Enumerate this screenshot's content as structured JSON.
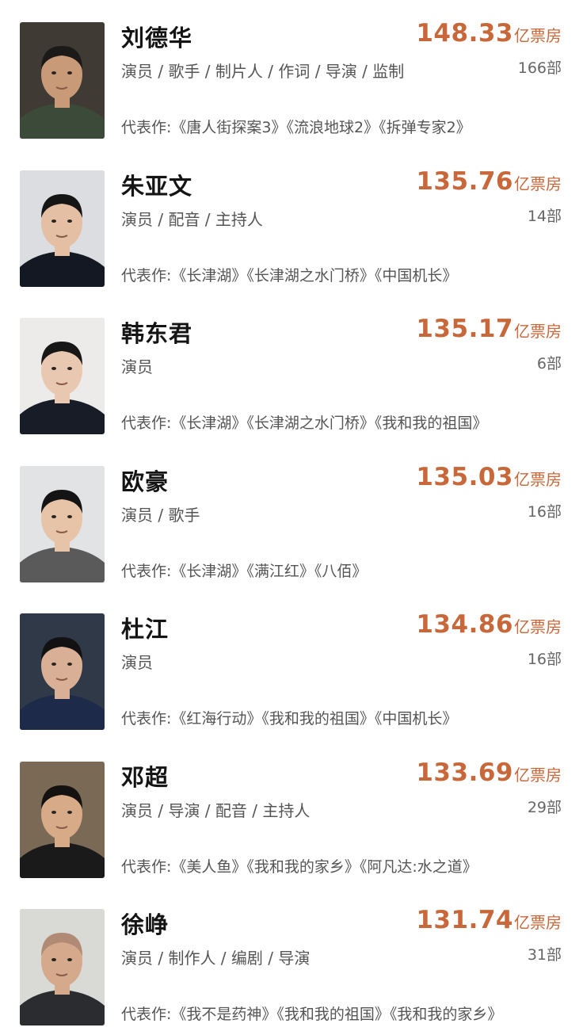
{
  "actors": [
    {
      "name": "刘德华",
      "roles": "演员 / 歌手 / 制片人 / 作词 / 导演 / 监制",
      "box_value": "148.33",
      "box_unit": "亿票房",
      "film_count": "166部",
      "works": "代表作:《唐人街探案3》《流浪地球2》《拆弹专家2》",
      "colors": {
        "bg": "#3f3a33",
        "shirt": "#3c4a3a",
        "skin": "#c99a78",
        "hair": "#1c1a18"
      }
    },
    {
      "name": "朱亚文",
      "roles": "演员 / 配音 / 主持人",
      "box_value": "135.76",
      "box_unit": "亿票房",
      "film_count": "14部",
      "works": "代表作:《长津湖》《长津湖之水门桥》《中国机长》",
      "colors": {
        "bg": "#dcdde0",
        "shirt": "#141822",
        "skin": "#e4bfa4",
        "hair": "#151515"
      }
    },
    {
      "name": "韩东君",
      "roles": "演员",
      "box_value": "135.17",
      "box_unit": "亿票房",
      "film_count": "6部",
      "works": "代表作:《长津湖》《长津湖之水门桥》《我和我的祖国》",
      "colors": {
        "bg": "#ecebe9",
        "shirt": "#181c26",
        "skin": "#e8c8b0",
        "hair": "#171717"
      }
    },
    {
      "name": "欧豪",
      "roles": "演员 / 歌手",
      "box_value": "135.03",
      "box_unit": "亿票房",
      "film_count": "16部",
      "works": "代表作:《长津湖》《满江红》《八佰》",
      "colors": {
        "bg": "#e2e3e5",
        "shirt": "#5a5a5a",
        "skin": "#e7c4a8",
        "hair": "#141414"
      }
    },
    {
      "name": "杜江",
      "roles": "演员",
      "box_value": "134.86",
      "box_unit": "亿票房",
      "film_count": "16部",
      "works": "代表作:《红海行动》《我和我的祖国》《中国机长》",
      "colors": {
        "bg": "#2f3948",
        "shirt": "#1d2a4a",
        "skin": "#d9b095",
        "hair": "#121212"
      }
    },
    {
      "name": "邓超",
      "roles": "演员 / 导演 / 配音 / 主持人",
      "box_value": "133.69",
      "box_unit": "亿票房",
      "film_count": "29部",
      "works": "代表作:《美人鱼》《我和我的家乡》《阿凡达:水之道》",
      "colors": {
        "bg": "#7a6a55",
        "shirt": "#1a1a1a",
        "skin": "#d8ab88",
        "hair": "#141210"
      }
    },
    {
      "name": "徐峥",
      "roles": "演员 / 制作人 / 编剧 / 导演",
      "box_value": "131.74",
      "box_unit": "亿票房",
      "film_count": "31部",
      "works": "代表作:《我不是药神》《我和我的祖国》《我和我的家乡》",
      "colors": {
        "bg": "#d9d9d6",
        "shirt": "#2a2c30",
        "skin": "#d5a98c",
        "hair": "#b08a74"
      }
    }
  ]
}
